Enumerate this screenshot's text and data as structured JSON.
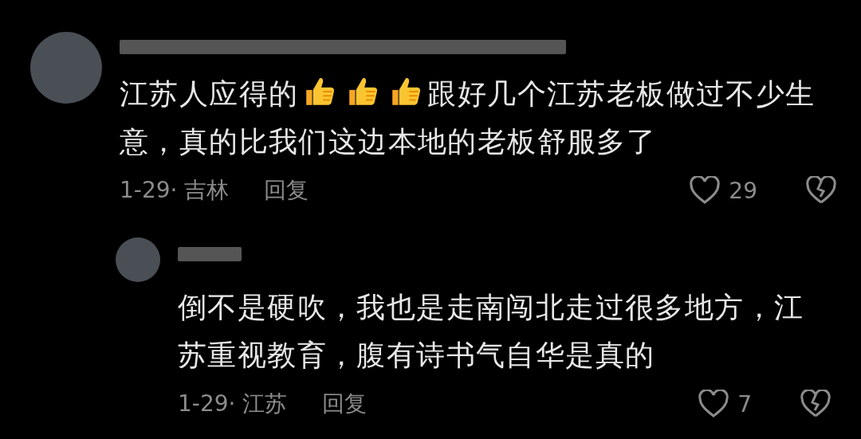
{
  "comments": [
    {
      "segments": [
        {
          "kind": "text",
          "text": "江苏人应得的"
        },
        {
          "kind": "thumbs-up"
        },
        {
          "kind": "thumbs-up"
        },
        {
          "kind": "thumbs-up"
        },
        {
          "kind": "text",
          "text": "跟好几个江苏老板做过不少生"
        },
        {
          "kind": "text",
          "text": "意，真的比我们这边本地的老板舒服多了"
        }
      ],
      "date": "1-29·",
      "location": "吉林",
      "reply_label": "回复",
      "likes": "29",
      "replies": [
        {
          "segments": [
            {
              "kind": "text",
              "text": "倒不是硬吹，我也是走南闯北走过很多地方，江苏重视教育，腹有诗书气自华是真的"
            }
          ],
          "date": "1-29·",
          "location": "江苏",
          "reply_label": "回复",
          "likes": "7"
        }
      ]
    }
  ]
}
